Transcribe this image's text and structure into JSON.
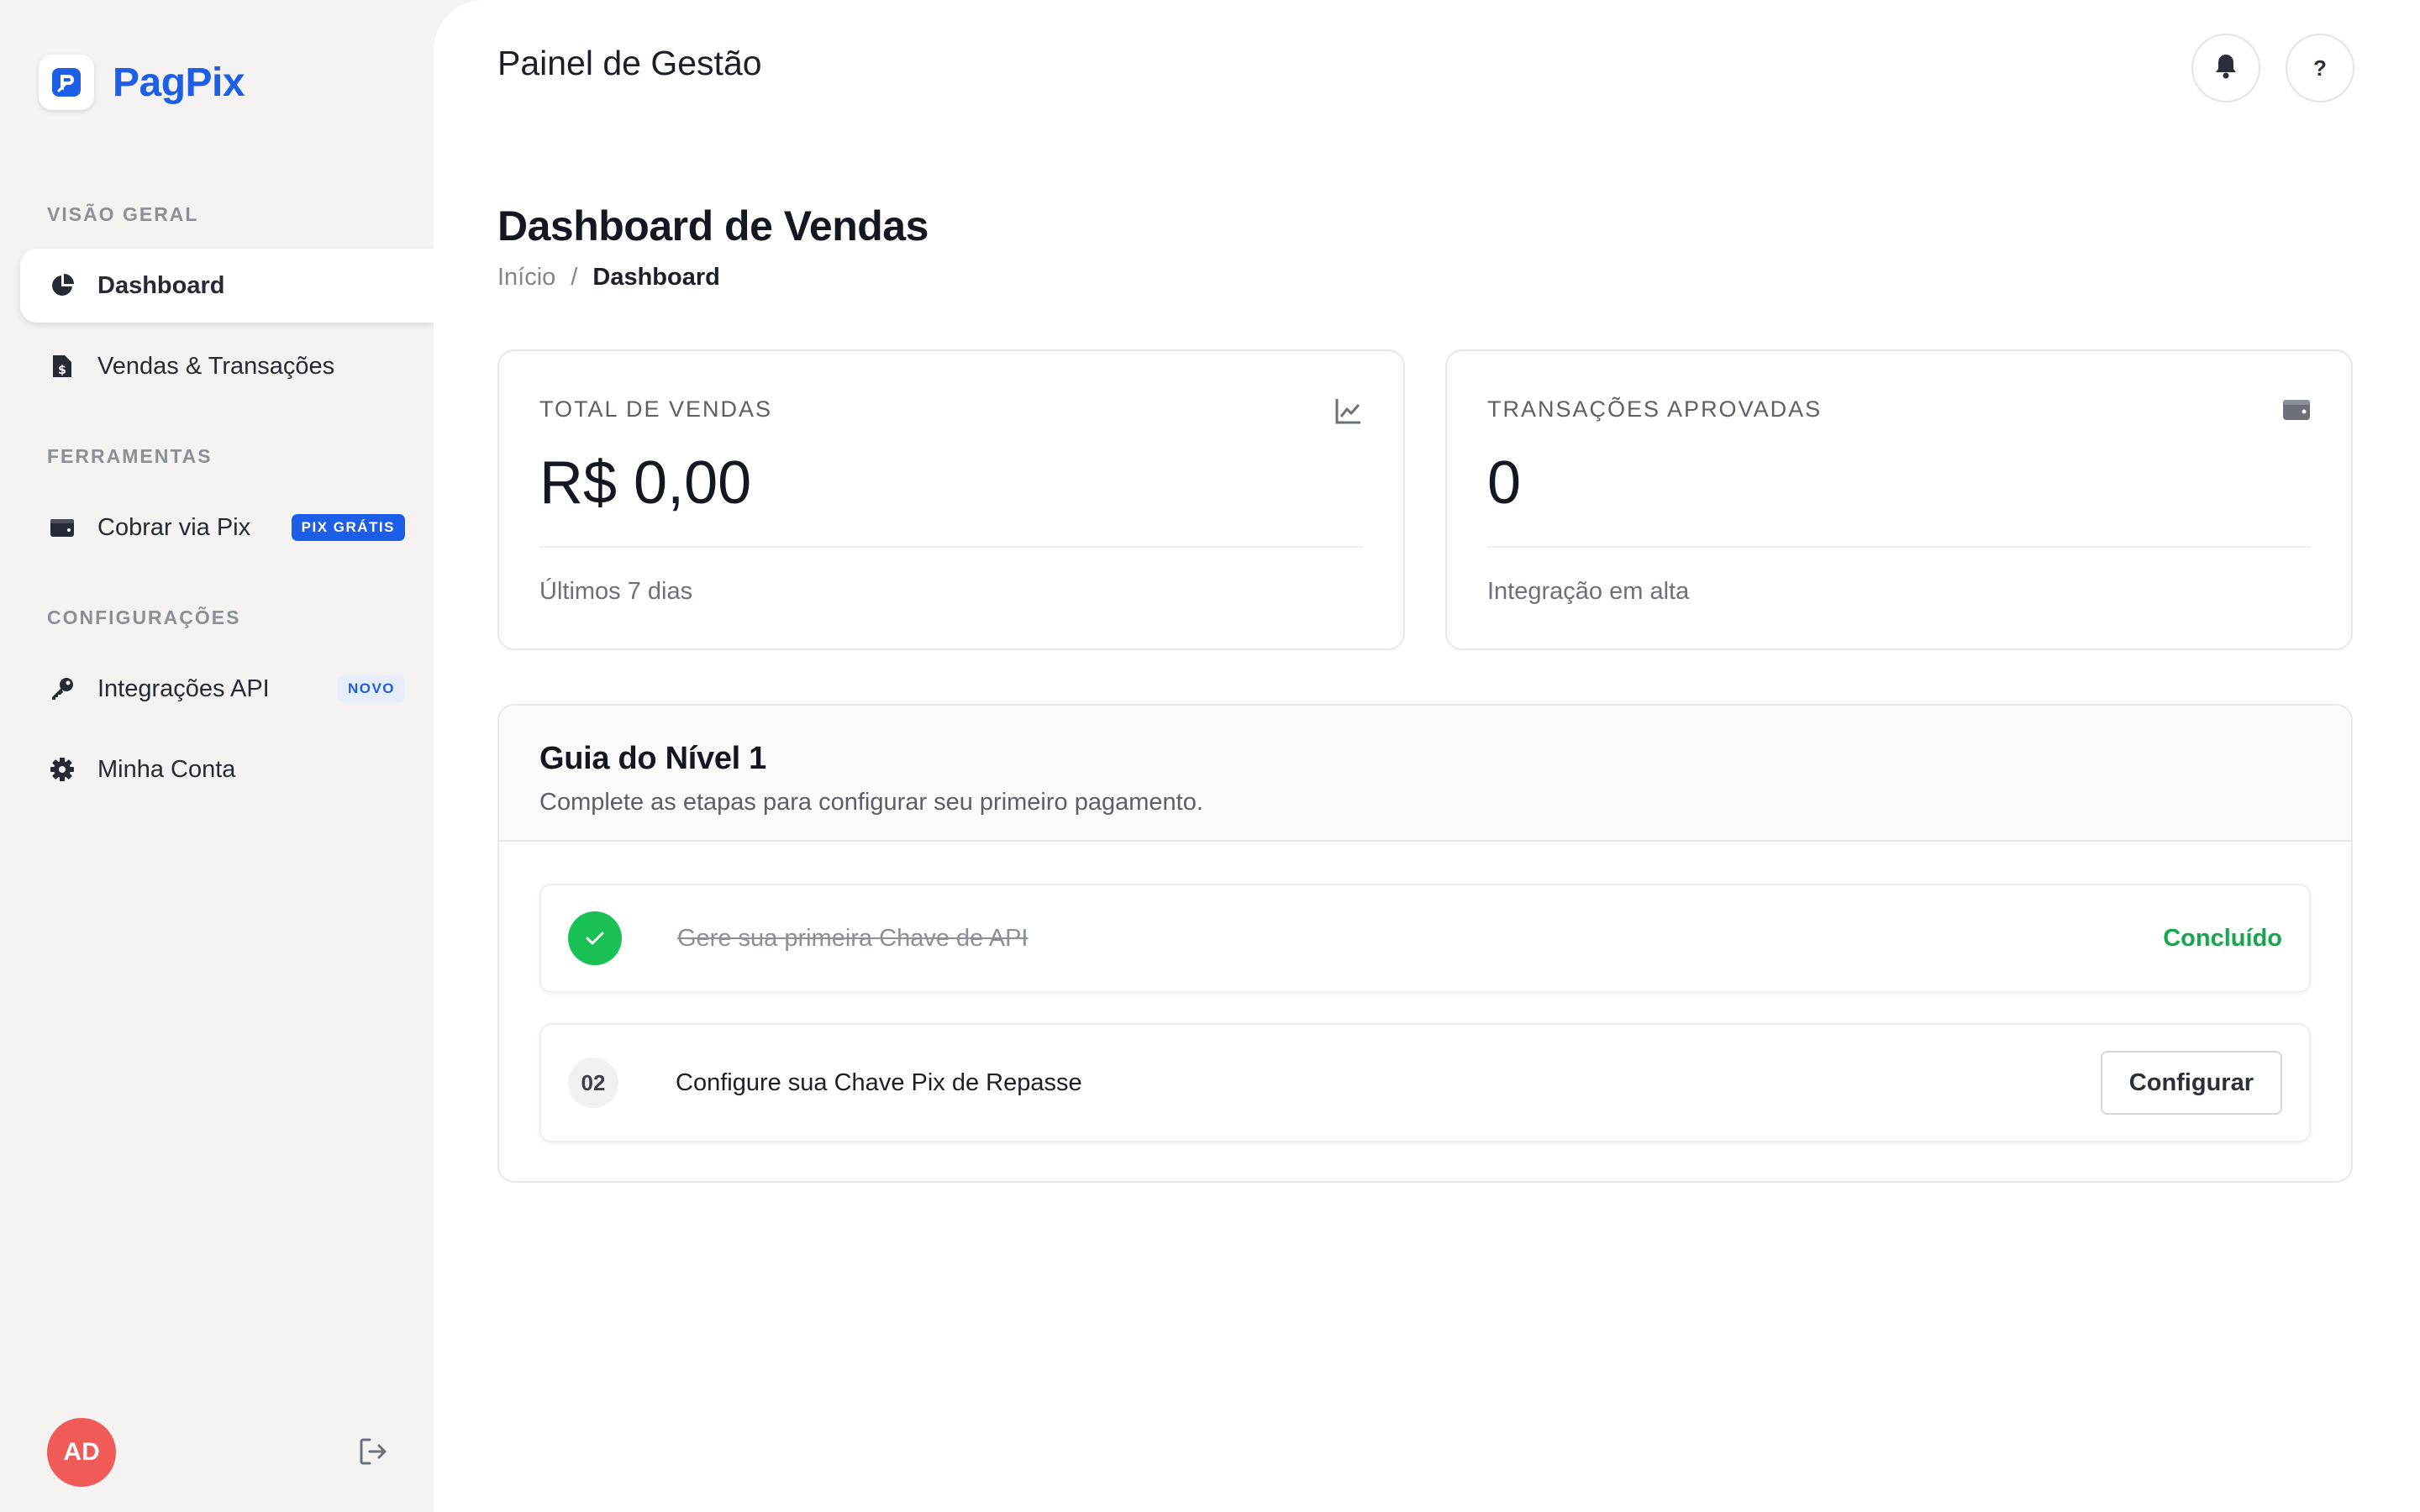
{
  "brand": {
    "name": "PagPix"
  },
  "sidebar": {
    "sections": {
      "overview": "VISÃO GERAL",
      "tools": "FERRAMENTAS",
      "settings": "CONFIGURAÇÕES"
    },
    "items": [
      {
        "label": "Dashboard",
        "icon": "pie-chart-icon",
        "active": true
      },
      {
        "label": "Vendas & Transações",
        "icon": "receipt-icon"
      },
      {
        "label": "Cobrar via Pix",
        "icon": "wallet-icon",
        "badge": "PIX GRÁTIS"
      },
      {
        "label": "Integrações API",
        "icon": "key-icon",
        "badge": "NOVO"
      },
      {
        "label": "Minha Conta",
        "icon": "gear-icon"
      }
    ],
    "user_initials": "AD"
  },
  "header": {
    "title": "Painel de Gestão",
    "help_label": "?"
  },
  "page": {
    "title": "Dashboard de Vendas",
    "breadcrumb": {
      "home": "Início",
      "separator": "/",
      "current": "Dashboard"
    }
  },
  "stats": [
    {
      "label": "TOTAL DE VENDAS",
      "value": "R$ 0,00",
      "sub": "Últimos 7 dias",
      "icon": "line-chart-icon"
    },
    {
      "label": "TRANSAÇÕES APROVADAS",
      "value": "0",
      "sub": "Integração em alta",
      "icon": "wallet-icon"
    }
  ],
  "guide": {
    "title": "Guia do Nível 1",
    "description": "Complete as etapas para configurar seu primeiro pagamento.",
    "steps": [
      {
        "text": "Gere sua primeira Chave de API",
        "status": "Concluído",
        "done": true
      },
      {
        "number": "02",
        "text": "Configure sua Chave Pix de Repasse",
        "action": "Configurar",
        "done": false
      }
    ]
  },
  "colors": {
    "brand": "#1d5ee8",
    "success": "#19c155",
    "avatar": "#f05b57"
  }
}
